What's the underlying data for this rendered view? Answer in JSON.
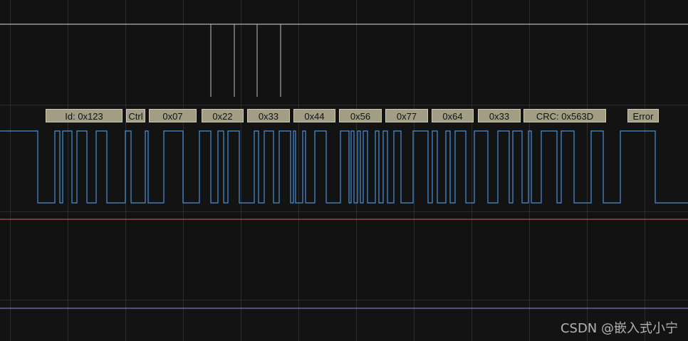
{
  "frame_fields": [
    {
      "label": "Id: 0x123"
    },
    {
      "label": "Ctrl"
    },
    {
      "label": "0x07"
    },
    {
      "label": "0x22"
    },
    {
      "label": "0x33"
    },
    {
      "label": "0x44"
    },
    {
      "label": "0x56"
    },
    {
      "label": "0x77"
    },
    {
      "label": "0x64"
    },
    {
      "label": "0x33"
    },
    {
      "label": "CRC: 0x563D"
    },
    {
      "label": "Error"
    }
  ],
  "colors": {
    "background": "#111111",
    "label_bg": "#a29e86",
    "can_signal": "#4a90d9",
    "top_channel": "#d8d8d8",
    "red_channel": "#e05a6a",
    "purple_channel": "#9b8ee6"
  },
  "watermark": "CSDN @嵌入式小宁"
}
